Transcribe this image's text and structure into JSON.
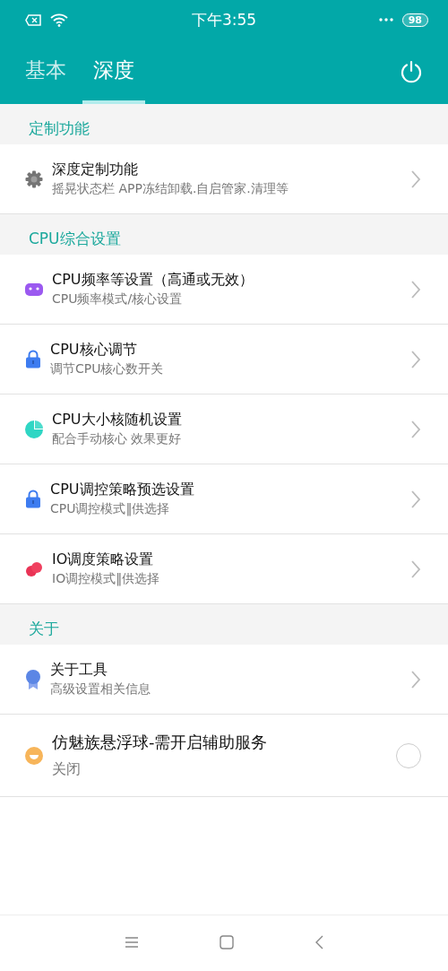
{
  "status_bar": {
    "time": "下午3:55",
    "battery": "98"
  },
  "tabs": [
    {
      "label": "基本",
      "selected": false
    },
    {
      "label": "深度",
      "selected": true
    }
  ],
  "sections": [
    {
      "title": "定制功能",
      "items": [
        {
          "kind": "link",
          "title": "深度定制功能",
          "subtitle": "摇晃状态栏 APP冻结卸载.自启管家.清理等"
        }
      ]
    },
    {
      "title": "CPU综合设置",
      "items": [
        {
          "kind": "link",
          "title": "CPU频率等设置（高通或无效）",
          "subtitle": "CPU频率模式/核心设置"
        },
        {
          "kind": "link",
          "title": "CPU核心调节",
          "subtitle": "调节CPU核心数开关"
        },
        {
          "kind": "link",
          "title": "CPU大小核随机设置",
          "subtitle": "配合手动核心 效果更好"
        },
        {
          "kind": "link",
          "title": "CPU调控策略预选设置",
          "subtitle": "CPU调控模式‖供选择"
        },
        {
          "kind": "link",
          "title": "IO调度策略设置",
          "subtitle": "IO调控模式‖供选择"
        }
      ]
    },
    {
      "title": "关于",
      "items": [
        {
          "kind": "link",
          "title": "关于工具",
          "subtitle": "高级设置相关信息"
        },
        {
          "kind": "toggle",
          "title": "仿魅族悬浮球-需开启辅助服务",
          "subtitle": "关闭",
          "on": false
        }
      ]
    }
  ]
}
